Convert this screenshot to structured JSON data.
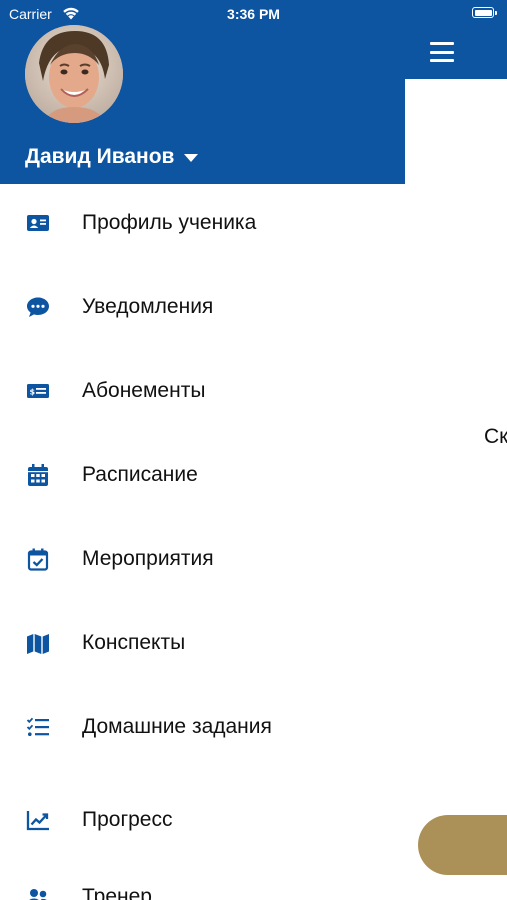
{
  "status_bar": {
    "carrier": "Carrier",
    "time": "3:36 PM"
  },
  "main": {
    "peek_text": "Ск",
    "fab_color": "#ab9158"
  },
  "drawer": {
    "accent_color": "#0d54a1",
    "user": {
      "name": "Давид Иванов",
      "avatar_icon": "user-photo"
    },
    "menu": [
      {
        "label": "Профиль ученика",
        "icon": "id-card-icon"
      },
      {
        "label": "Уведомления",
        "icon": "chat-bubble-icon"
      },
      {
        "label": "Абонементы",
        "icon": "money-bill-icon"
      },
      {
        "label": "Расписание",
        "icon": "calendar-grid-icon"
      },
      {
        "label": "Мероприятия",
        "icon": "calendar-check-icon"
      },
      {
        "label": "Конспекты",
        "icon": "map-icon"
      },
      {
        "label": "Домашние задания",
        "icon": "checklist-icon"
      },
      {
        "label": "Прогресс",
        "icon": "chart-line-icon"
      },
      {
        "label": "Тренер",
        "icon": "users-icon"
      }
    ]
  }
}
